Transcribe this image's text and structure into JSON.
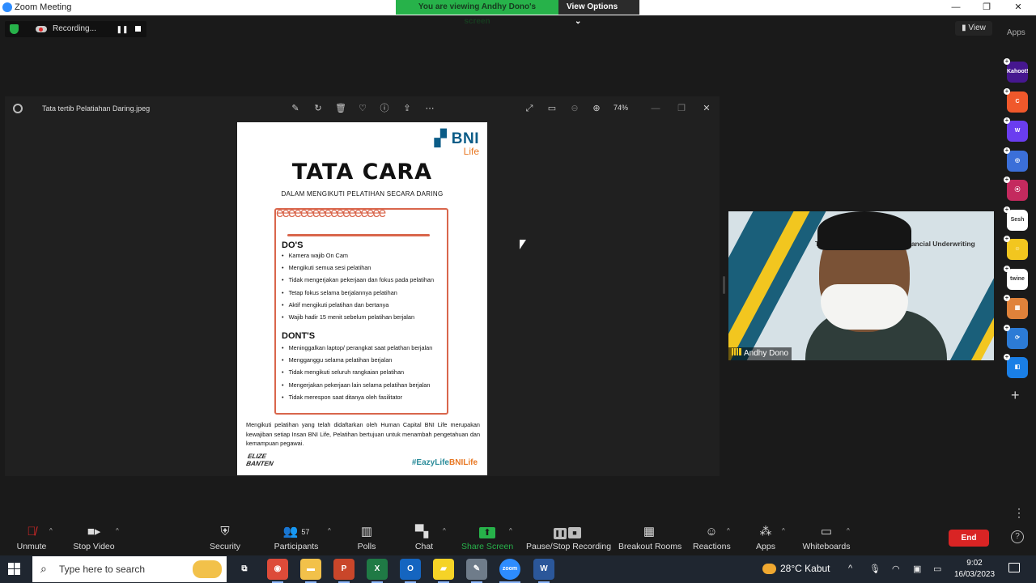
{
  "window": {
    "title": "Zoom Meeting",
    "controls": {
      "minimize": "—",
      "maximize": "❐",
      "close": "✕"
    }
  },
  "share_banner": {
    "message": "You are viewing Andhy Dono's screen",
    "options_label": "View Options",
    "options_caret": "⌄"
  },
  "recording": {
    "status": "Recording...",
    "pause_icon": "❚❚"
  },
  "view_button": "▮ View",
  "apps_panel_label": "Apps",
  "viewer": {
    "file_name": "Tata tertib Pelatiahan Daring.jpeg",
    "zoom_level": "74%",
    "toolbar_icons": [
      "edit-icon",
      "rotate-icon",
      "delete-icon",
      "favorite-icon",
      "info-icon",
      "share-icon",
      "more-icon"
    ],
    "window_icons": [
      "fullscreen-icon",
      "fit-icon",
      "zoom-out-icon",
      "zoom-in-icon"
    ]
  },
  "poster": {
    "logo_bni": "BNI",
    "logo_life": "Life",
    "title": "TATA CARA",
    "subtitle": "DALAM MENGIKUTI PELATIHAN SECARA DARING",
    "wavy": "eeeeeeeeeeeeeeeeee",
    "dos_heading": "DO'S",
    "dos": [
      "Kamera wajib On Cam",
      "Mengikuti semua sesi pelatihan",
      "Tidak mengerjakan pekerjaan dan fokus pada pelatihan",
      "Tetap fokus selama berjalannya pelatihan",
      "Aktif mengikuti pelatihan dan bertanya",
      "Wajib hadir 15 menit sebelum pelatihan berjalan"
    ],
    "donts_heading": "DONT'S",
    "donts": [
      "Meninggalkan laptop/ perangkat saat pelathan berjalan",
      "Mengganggu selama pelatihan berjalan",
      "Tidak mengikuti seluruh rangkaian pelatihan",
      "Mengerjakan pekerjaan lain selama pelatihan berjalan",
      "Tidak merespon saat ditanya oleh fasilitator"
    ],
    "footer": "Mengikuti pelatihan yang telah didaftarkan oleh Human Capital BNI Life merupakan kewajiban setiap Insan BNI Life, Pelatihan bertujuan untuk menambah pengetahuan dan kemampuan pegawai.",
    "event_logo": "ELIZE BANTEN",
    "hashtag_a": "#EazyLife",
    "hashtag_b": "BNILife"
  },
  "video": {
    "participant_name": "Andhy Dono",
    "slide_text_left": "Tr",
    "slide_text_right": "k Financial Underwriting"
  },
  "apps": [
    {
      "name": "Kahoot!",
      "color": "#46178f"
    },
    {
      "name": "C",
      "color": "#f0582b"
    },
    {
      "name": "W",
      "color": "#6a3df0"
    },
    {
      "name": "◎",
      "color": "#3b6fd9"
    },
    {
      "name": "⦿",
      "color": "#c42a5e"
    },
    {
      "name": "Sesh",
      "color": "#ffffff"
    },
    {
      "name": "☺",
      "color": "#f2c61f"
    },
    {
      "name": "twine",
      "color": "#ffffff"
    },
    {
      "name": "▦",
      "color": "#e0823a"
    },
    {
      "name": "⟳",
      "color": "#2c7bd6"
    },
    {
      "name": "◧",
      "color": "#1a7fe6"
    }
  ],
  "toolbar": {
    "unmute": "Unmute",
    "stop_video": "Stop Video",
    "security": "Security",
    "participants": "Participants",
    "participants_count": "57",
    "polls": "Polls",
    "chat": "Chat",
    "share_screen": "Share Screen",
    "pause_stop_recording": "Pause/Stop Recording",
    "breakout_rooms": "Breakout Rooms",
    "reactions": "Reactions",
    "apps": "Apps",
    "whiteboards": "Whiteboards",
    "end": "End",
    "caret": "^",
    "more": "⋮",
    "help": "?"
  },
  "taskbar": {
    "search_placeholder": "Type here to search",
    "weather_temp": "28°C",
    "weather_desc": "Kabut",
    "time": "9:02",
    "date": "16/03/2023",
    "apps": [
      {
        "name": "task-view",
        "label": "⧉",
        "color": "transparent"
      },
      {
        "name": "chrome",
        "label": "◉",
        "color": "#dd4b39"
      },
      {
        "name": "file-explorer",
        "label": "▬",
        "color": "#f2c14a"
      },
      {
        "name": "powerpoint",
        "label": "P",
        "color": "#c9462a"
      },
      {
        "name": "excel",
        "label": "X",
        "color": "#1f7a45"
      },
      {
        "name": "outlook",
        "label": "O",
        "color": "#1565c0"
      },
      {
        "name": "sticky-notes",
        "label": "▰",
        "color": "#f5d327"
      },
      {
        "name": "pen-app",
        "label": "✎",
        "color": "#6f7c8a"
      },
      {
        "name": "zoom",
        "label": "zoom",
        "color": "#2d8cff"
      },
      {
        "name": "word",
        "label": "W",
        "color": "#2b579a"
      }
    ],
    "tray": {
      "chevron": "^",
      "mic": "🎙",
      "wifi": "◠",
      "battery": "▭",
      "notif": ""
    }
  }
}
